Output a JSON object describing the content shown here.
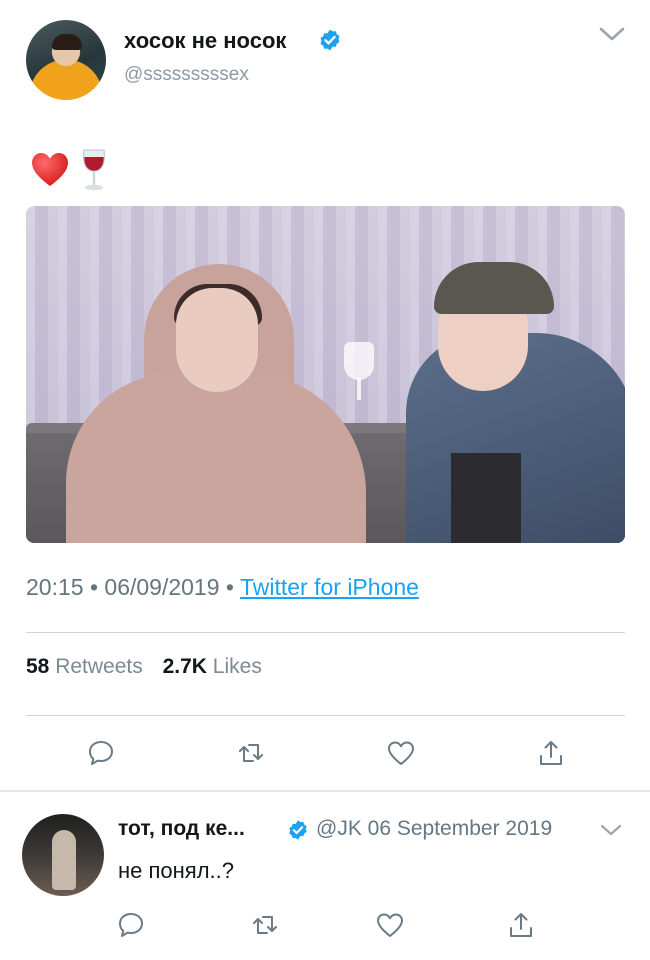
{
  "tweet": {
    "display_name": "хосок не носок",
    "handle": "@sssssssssex",
    "emojis": [
      "red-heart",
      "wine-glass"
    ],
    "media_alt": "photo",
    "time": "20:15",
    "separator": "•",
    "date": "06/09/2019",
    "source": "Twitter for iPhone",
    "retweets_count": "58",
    "retweets_label": "Retweets",
    "likes_count": "2.7K",
    "likes_label": "Likes",
    "actions": [
      "reply-icon",
      "retweet-icon",
      "like-icon",
      "share-icon"
    ]
  },
  "reply": {
    "display_name": "тот, под ке...",
    "handle_date": "@JK 06 September 2019",
    "text": "не понял..?",
    "actions": [
      "reply-icon",
      "retweet-icon",
      "like-icon",
      "share-icon"
    ]
  },
  "colors": {
    "accent": "#1da1f2",
    "text": "#14171a",
    "secondary": "#657786",
    "divider": "#cfd6dc"
  }
}
